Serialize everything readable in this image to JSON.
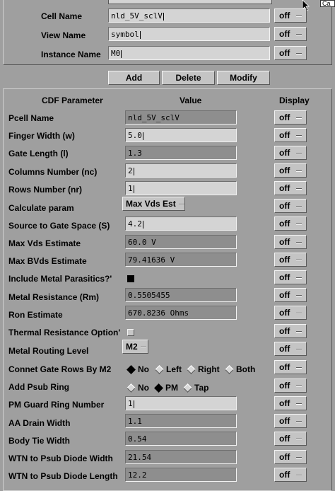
{
  "top": {
    "cell_name_label": "Cell Name",
    "cell_name_value": "nld_5V_sclV",
    "view_name_label": "View Name",
    "view_name_value": "symbol",
    "instance_name_label": "Instance Name",
    "instance_name_value": "M0",
    "display": "off"
  },
  "corner_label": "Ca",
  "buttons": {
    "add": "Add",
    "delete": "Delete",
    "modify": "Modify"
  },
  "headers": {
    "param": "CDF Parameter",
    "value": "Value",
    "display": "Display"
  },
  "params": [
    {
      "label": "Pcell Name",
      "value": "nld_5V_sclV",
      "display": "off"
    },
    {
      "label": "Finger Width (w)",
      "value": "5.0",
      "display": "off"
    },
    {
      "label": "Gate Length (l)",
      "value": "1.3",
      "display": "off"
    },
    {
      "label": "Columns Number (nc)",
      "value": "2",
      "display": "off"
    },
    {
      "label": "Rows Number (nr)",
      "value": "1",
      "display": "off"
    },
    {
      "label": "Calculate param",
      "value": "Max Vds Est",
      "display": "off"
    },
    {
      "label": "Source to Gate Space (S)",
      "value": "4.2",
      "display": "off"
    },
    {
      "label": "Max Vds Estimate",
      "value": "60.0 V",
      "display": "off"
    },
    {
      "label": "Max BVds Estimate",
      "value": "79.41636 V",
      "display": "off"
    },
    {
      "label": "Include Metal Parasitics?'",
      "value": "",
      "display": "off"
    },
    {
      "label": "Metal Resistance (Rm)",
      "value": "0.5505455",
      "display": "off"
    },
    {
      "label": "Ron Estimate",
      "value": "670.8236 Ohms",
      "display": "off"
    },
    {
      "label": "Thermal Resistance Option'",
      "value": "",
      "display": "off"
    },
    {
      "label": "Metal Routing Level",
      "value": "M2",
      "display": "off"
    },
    {
      "label": "Connet Gate Rows By M2",
      "value": "",
      "display": "off"
    },
    {
      "label": "Add Psub Ring",
      "value": "",
      "display": "off"
    },
    {
      "label": "PM Guard Ring Number",
      "value": "1",
      "display": "off"
    },
    {
      "label": "AA Drain Width",
      "value": "1.1",
      "display": "off"
    },
    {
      "label": "Body Tie Width",
      "value": "0.54",
      "display": "off"
    },
    {
      "label": "WTN to Psub Diode Width",
      "value": "21.54",
      "display": "off"
    },
    {
      "label": "WTN to Psub Diode Length",
      "value": "12.2",
      "display": "off"
    }
  ],
  "gate_rows_options": {
    "no": "No",
    "left": "Left",
    "right": "Right",
    "both": "Both",
    "selected": "No"
  },
  "psub_ring_options": {
    "no": "No",
    "pm": "PM",
    "tap": "Tap",
    "selected": "PM"
  },
  "include_metal_parasitics_checked": true,
  "thermal_resistance_checked": false
}
